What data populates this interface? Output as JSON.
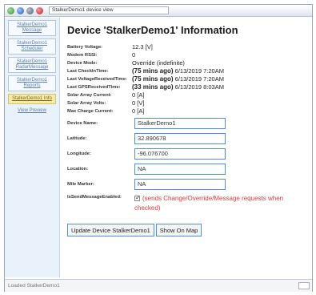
{
  "titlebar": {
    "address": "StalkerDemo1 device view"
  },
  "sidebar": {
    "items": [
      {
        "label": "StalkerDemo1 Message"
      },
      {
        "label": "StalkerDemo1 Scheduler"
      },
      {
        "label": "StalkerDemo1 RadarMessage"
      },
      {
        "label": "StalkerDemo1 Reports"
      },
      {
        "label": "StalkerDemo1 Info"
      },
      {
        "label": "View Preview"
      }
    ]
  },
  "page": {
    "title": "Device 'StalkerDemo1' Information"
  },
  "info": [
    {
      "label": "Battery Voltage:",
      "value": "12.3 [V]"
    },
    {
      "label": "Modem RSSI:",
      "value": "0"
    },
    {
      "label": "Device Mode:",
      "value": "Override (indefinite)"
    },
    {
      "label": "Last CheckInTime:",
      "ago": "(75 mins ago)",
      "value": "6/13/2019 7:20AM"
    },
    {
      "label": "Last VoltageReceivedTime:",
      "ago": "(75 mins ago)",
      "value": "6/13/2019 7:20AM"
    },
    {
      "label": "Last GPSReceivedTime:",
      "ago": "(33 mins ago)",
      "value": "6/13/2019 8:03AM"
    },
    {
      "label": "Solar Array Current:",
      "value": "0 [A]"
    },
    {
      "label": "Solar Array Volts:",
      "value": "0 [V]"
    },
    {
      "label": "Max Charge Current:",
      "value": "0 [A]"
    }
  ],
  "form": {
    "device_name": {
      "label": "Device Name:",
      "value": "StalkerDemo1"
    },
    "latitude": {
      "label": "Latitude:",
      "value": "32.890678"
    },
    "longitude": {
      "label": "Longitude:",
      "value": "-96.076700"
    },
    "location": {
      "label": "Location:",
      "value": "NA"
    },
    "mile_marker": {
      "label": "Mile Marker:",
      "value": "NA"
    }
  },
  "checkbox": {
    "label": "IsSendMessageEnabled:",
    "checked": true,
    "text": "(sends Change/Override/Message requests when checked)"
  },
  "buttons": {
    "update": "Update Device StalkerDemo1",
    "map": "Show On Map"
  },
  "status": {
    "text": "Loaded StalkerDemo1"
  },
  "colors": {
    "accent_border": "#4f8fd6",
    "warning_text": "#e03a3a",
    "sidebar_bg": "#e9f1fb",
    "active_item_bg": "#f5eba6"
  }
}
